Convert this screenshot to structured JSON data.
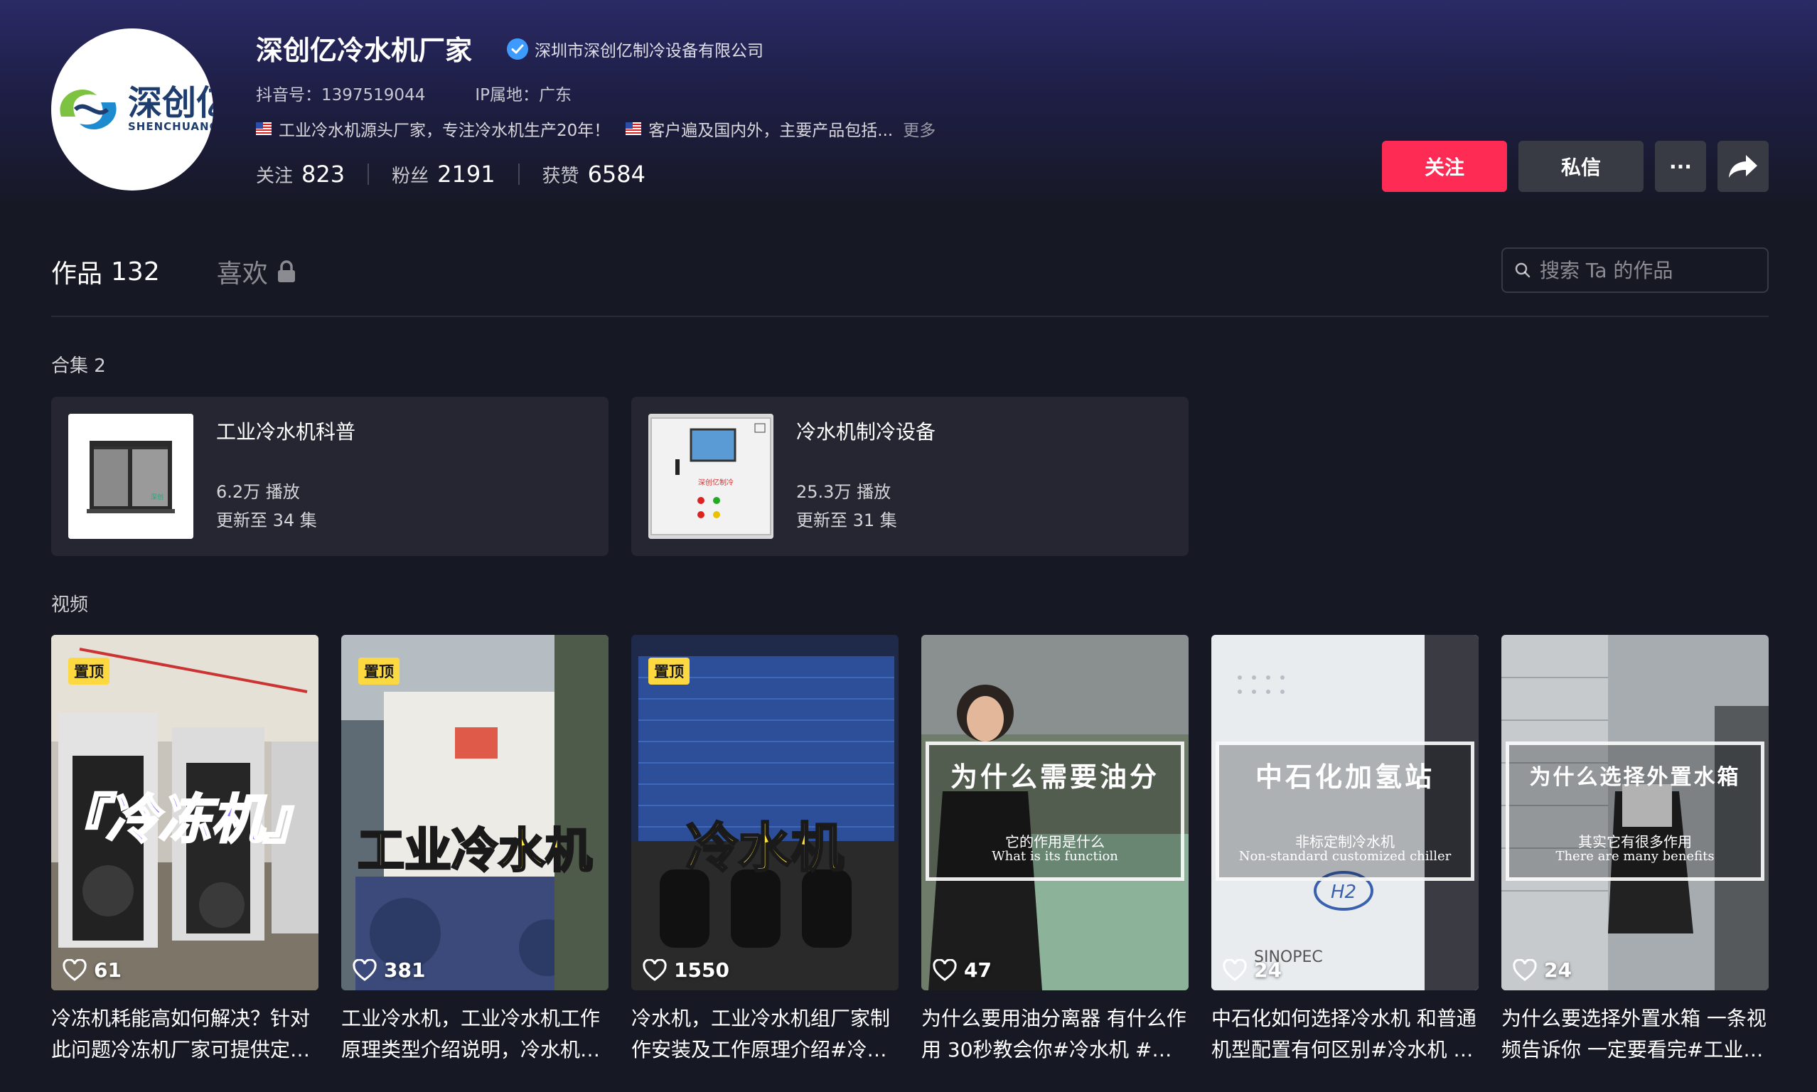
{
  "profile": {
    "avatar_logo_cn": "深创亿",
    "avatar_logo_en": "SHENCHUANGYI",
    "name": "深创亿冷水机厂家",
    "verified_company": "深圳市深创亿制冷设备有限公司",
    "douyin_id": "抖音号：1397519044",
    "ip_location": "IP属地：广东",
    "bio_1": "工业冷水机源头厂家，专注冷水机生产20年！",
    "bio_2": "客户遍及国内外，主要产品包括...",
    "bio_more": "更多",
    "stats": [
      {
        "label": "关注",
        "value": "823"
      },
      {
        "label": "粉丝",
        "value": "2191"
      },
      {
        "label": "获赞",
        "value": "6584"
      }
    ]
  },
  "actions": {
    "follow": "关注",
    "message": "私信",
    "more": "···"
  },
  "tabs": {
    "works_label": "作品",
    "works_count": "132",
    "likes_label": "喜欢"
  },
  "search": {
    "placeholder": "搜索 Ta 的作品"
  },
  "collections": {
    "heading": "合集 2",
    "items": [
      {
        "title": "工业冷水机科普",
        "plays": "6.2万 播放",
        "updated": "更新至 34 集"
      },
      {
        "title": "冷水机制冷设备",
        "plays": "25.3万 播放",
        "updated": "更新至 31 集"
      }
    ]
  },
  "videos": {
    "heading": "视频",
    "pin_label": "置顶",
    "items": [
      {
        "likes": "61",
        "overlay": "『冷冻机』",
        "desc": "冷冻机耗能高如何解决？针对此问题冷冻机厂家可提供定制方案"
      },
      {
        "likes": "381",
        "overlay": "工业冷水机",
        "desc": "工业冷水机，工业冷水机工作原理类型介绍说明，冷水机厂家"
      },
      {
        "likes": "1550",
        "overlay": "冷水机",
        "desc": "冷水机，工业冷水机组厂家制作安装及工作原理介绍#冷水机"
      },
      {
        "likes": "47",
        "overlay_title": "为什么需要油分",
        "overlay_sub": "它的作用是什么",
        "overlay_sub_en": "What is its function",
        "desc": "为什么要用油分离器 有什么作用 30秒教会你#冷水机 #冷冻机"
      },
      {
        "likes": "24",
        "overlay_title": "中石化加氢站",
        "overlay_sub": "非标定制冷水机",
        "overlay_sub_en": "Non-standard customized chiller",
        "desc": "中石化如何选择冷水机 和普通机型配置有何区别#冷水机 #冷冻机"
      },
      {
        "likes": "24",
        "overlay_title": "为什么选择外置水箱",
        "overlay_sub": "其实它有很多作用",
        "overlay_sub_en": "There are many benefits",
        "desc": "为什么要选择外置水箱 一条视频告诉你 一定要看完#工业冷水机"
      }
    ]
  },
  "colors": {
    "background": "#161823",
    "follow_button": "#fe2c55",
    "secondary_button": "#393b44",
    "card": "#252632",
    "pin_badge": "#fdd941",
    "verified": "#3d9bff"
  }
}
